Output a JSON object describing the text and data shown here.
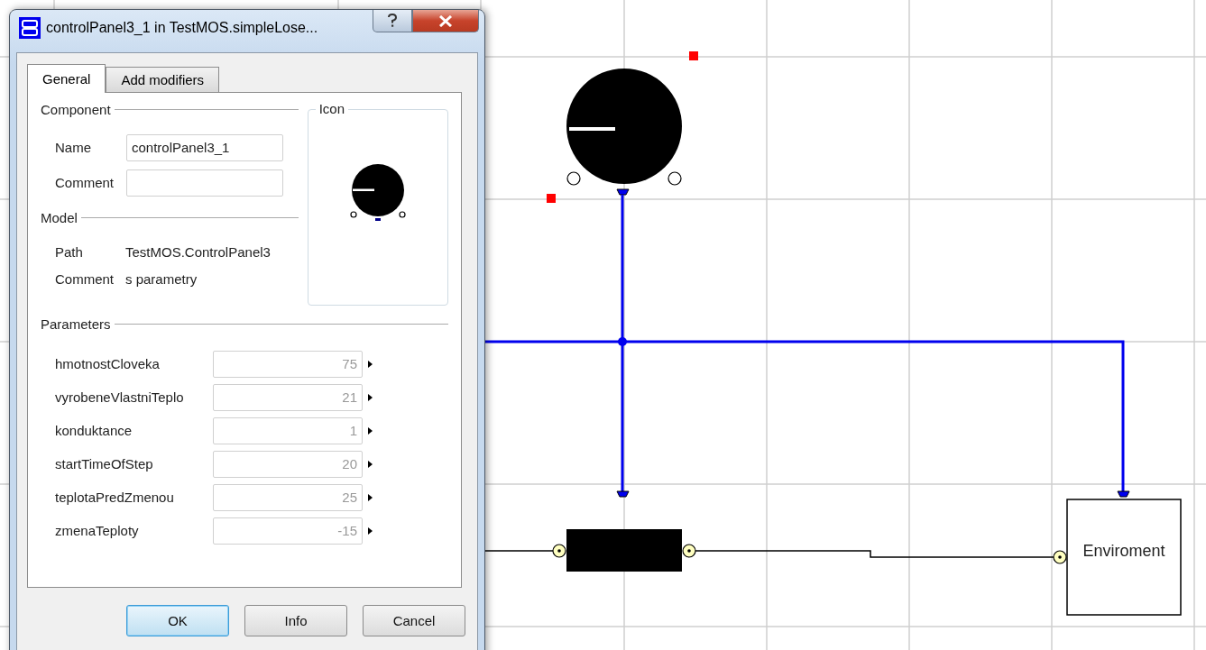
{
  "window": {
    "title": "controlPanel3_1 in TestMOS.simpleLose..."
  },
  "tabs": [
    {
      "label": "General",
      "selected": true
    },
    {
      "label": "Add modifiers",
      "selected": false
    }
  ],
  "component": {
    "heading": "Component",
    "fields": [
      {
        "label": "Name",
        "value": "controlPanel3_1"
      },
      {
        "label": "Comment"
      }
    ]
  },
  "icon_group": {
    "heading": "Icon"
  },
  "model": {
    "heading": "Model",
    "rows": [
      {
        "label": "Path",
        "value": "TestMOS.ControlPanel3"
      },
      {
        "label": "Comment",
        "value": "s parametry"
      }
    ]
  },
  "parameters": {
    "heading": "Parameters",
    "rows": [
      {
        "label": "hmotnostCloveka",
        "placeholder": "75"
      },
      {
        "label": "vyrobeneVlastniTeplo",
        "placeholder": "21"
      },
      {
        "label": "konduktance",
        "placeholder": "1"
      },
      {
        "label": "startTimeOfStep",
        "placeholder": "20"
      },
      {
        "label": "teplotaPredZmenou",
        "placeholder": "25"
      },
      {
        "label": "zmenaTeploty",
        "placeholder": "-15"
      }
    ]
  },
  "buttons": [
    {
      "label": "OK",
      "default": true
    },
    {
      "label": "Info",
      "default": false
    },
    {
      "label": "Cancel",
      "default": false
    }
  ],
  "diagram": {
    "environment_label": "Enviroment"
  }
}
